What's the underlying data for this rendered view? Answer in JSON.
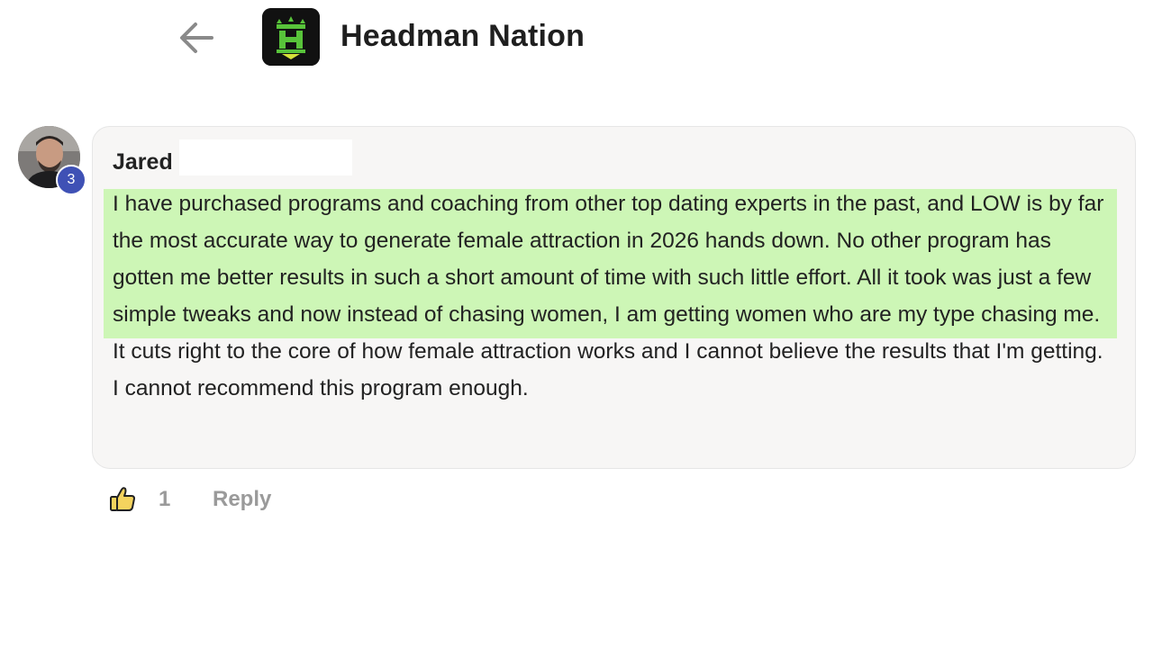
{
  "header": {
    "back_icon": "arrow-left-icon",
    "group_logo_icon": "headman-logo-icon",
    "group_name": "Headman Nation"
  },
  "comment": {
    "author": {
      "first_name": "Jared",
      "avatar_icon": "user-avatar",
      "level": "3"
    },
    "highlighted_text": "I have purchased programs and coaching from other top dating experts in the past, and LOW is by far the most accurate way to generate female attraction in 2026 hands down. No other program has gotten me better results in such a short amount of time with such little effort. All it took was just a few simple tweaks and now instead of chasing women, I am",
    "remaining_text": " getting women who are my type chasing me. It cuts right to the core of how female attraction works and I cannot believe the results that I'm getting. I cannot recommend this program enough.",
    "highlight_color": "#cdf6b6"
  },
  "actions": {
    "like_icon": "thumbs-up-icon",
    "like_count": "1",
    "reply_label": "Reply"
  },
  "colors": {
    "badge": "#3f51b5",
    "bubble_background": "#f7f6f5",
    "action_text": "#9a9a9a"
  }
}
